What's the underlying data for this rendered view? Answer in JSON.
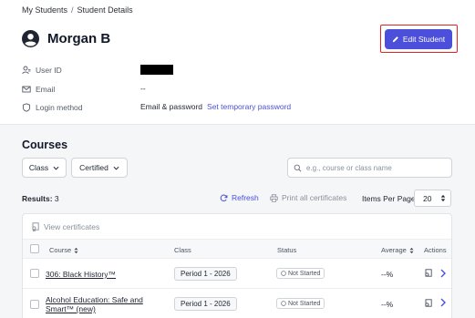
{
  "breadcrumb": {
    "parent": "My Students",
    "separator": "/",
    "current": "Student Details"
  },
  "student": {
    "name": "Morgan B"
  },
  "header": {
    "edit_label": "Edit Student"
  },
  "info": {
    "user_id_label": "User ID",
    "email_label": "Email",
    "email_value": "--",
    "login_label": "Login method",
    "login_value": "Email & password",
    "set_password_link": "Set temporary password"
  },
  "courses": {
    "title": "Courses",
    "filters": {
      "class_label": "Class",
      "certified_label": "Certified"
    },
    "search_placeholder": "e.g., course or class name",
    "results_label": "Results:",
    "results_count": "3",
    "refresh_label": "Refresh",
    "print_all_label": "Print all certificates",
    "items_per_page_label": "Items Per Page:",
    "items_per_page_value": "20",
    "view_certificates_label": "View certificates",
    "columns": {
      "course": "Course",
      "class": "Class",
      "status": "Status",
      "average": "Average",
      "actions": "Actions"
    },
    "rows": [
      {
        "course": "306: Black History™",
        "class": "Period 1 - 2026",
        "status": "Not Started",
        "average": "--%"
      },
      {
        "course": "Alcohol Education: Safe and Smart™ (new)",
        "class": "Period 1 - 2026",
        "status": "Not Started",
        "average": "--%"
      }
    ]
  },
  "colors": {
    "accent": "#4c4fd9",
    "highlight": "#e02424"
  },
  "icons": [
    "user-circle-icon",
    "pencil-icon",
    "user-id-icon",
    "mail-icon",
    "shield-icon",
    "chevron-down-icon",
    "search-icon",
    "refresh-icon",
    "printer-icon",
    "sort-icon",
    "certificate-icon",
    "chevron-right-icon",
    "clock-icon"
  ]
}
